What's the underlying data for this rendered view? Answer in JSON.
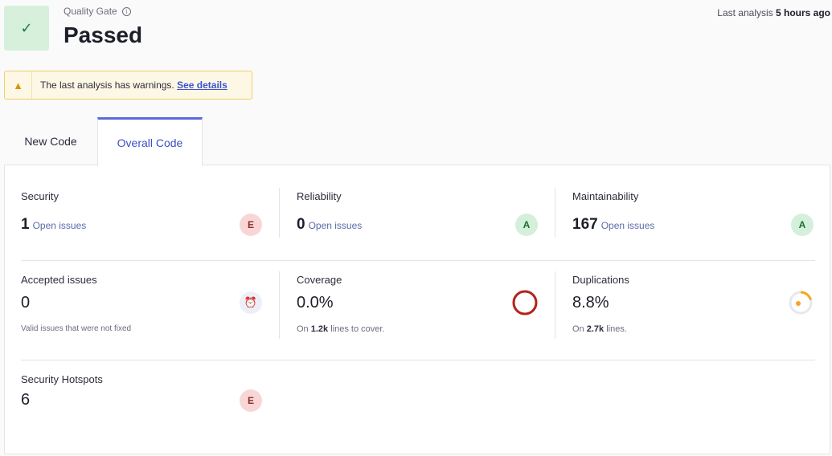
{
  "quality_gate": {
    "label": "Quality Gate",
    "status": "Passed",
    "check_icon": "✓"
  },
  "last_analysis": {
    "prefix": "Last analysis ",
    "value": "5 hours ago"
  },
  "warning": {
    "icon": "warning-icon",
    "text": "The last analysis has warnings.",
    "link": "See details"
  },
  "tabs": [
    {
      "label": "New Code"
    },
    {
      "label": "Overall Code"
    }
  ],
  "metrics": {
    "security": {
      "title": "Security",
      "value": "1",
      "suffix": "Open issues",
      "rating": "E"
    },
    "reliability": {
      "title": "Reliability",
      "value": "0",
      "suffix": "Open issues",
      "rating": "A"
    },
    "maintainability": {
      "title": "Maintainability",
      "value": "167",
      "suffix": "Open issues",
      "rating": "A"
    },
    "accepted": {
      "title": "Accepted issues",
      "value": "0",
      "note": "Valid issues that were not fixed"
    },
    "coverage": {
      "title": "Coverage",
      "value": "0.0%",
      "sub_prefix": "On ",
      "sub_value": "1.2k",
      "sub_suffix": " lines to cover.",
      "percent": 0
    },
    "duplications": {
      "title": "Duplications",
      "value": "8.8%",
      "sub_prefix": "On ",
      "sub_value": "2.7k",
      "sub_suffix": " lines.",
      "percent": 8.8
    },
    "hotspots": {
      "title": "Security Hotspots",
      "value": "6",
      "rating": "E"
    }
  },
  "colors": {
    "passed_bg": "#d6f0dc",
    "accent": "#3c4fc6",
    "rating_e": "#f9d6d6",
    "rating_a": "#d4f0da",
    "coverage_ring": "#b42318",
    "duplication_ring": "#f5a623"
  }
}
